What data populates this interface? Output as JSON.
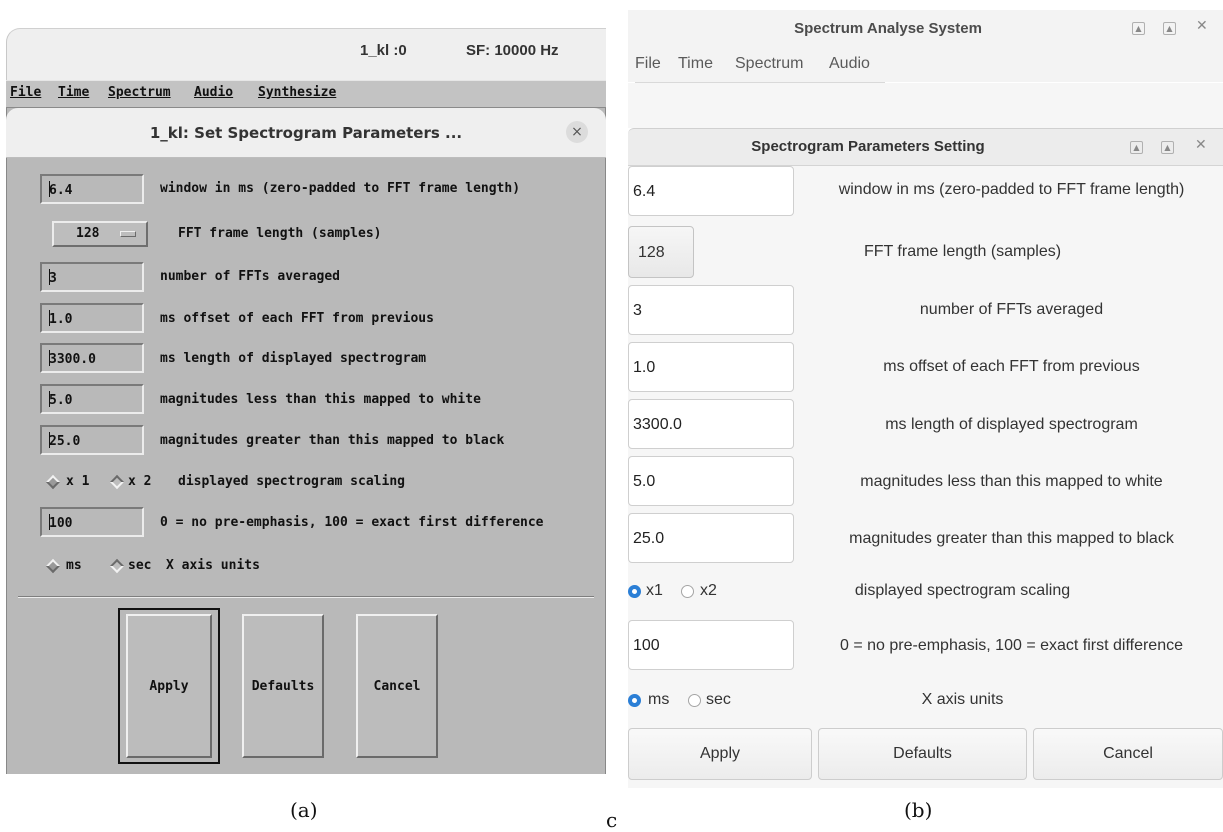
{
  "panel_a": {
    "window_file": "1_kl :0",
    "sample_rate": "SF: 10000 Hz",
    "menu": [
      "File",
      "Time",
      "Spectrum",
      "Audio",
      "Synthesize"
    ],
    "dialog_title": "1_kl:  Set Spectrogram Parameters ...",
    "close_glyph": "×",
    "window_ms": {
      "value": "6.4",
      "label": "window in ms (zero-padded to FFT frame length)"
    },
    "fft_length": {
      "value": "128",
      "label": "FFT frame length (samples)"
    },
    "num_ffts": {
      "value": "3",
      "label": "number of FFTs averaged"
    },
    "offset": {
      "value": "1.0",
      "label": "ms offset of each FFT from previous"
    },
    "length": {
      "value": "3300.0",
      "label": "ms length of displayed spectrogram"
    },
    "mag_white": {
      "value": "5.0",
      "label": "magnitudes less than this mapped to white"
    },
    "mag_black": {
      "value": "25.0",
      "label": "magnitudes greater than this mapped to black"
    },
    "scaling": {
      "opt1": "x 1",
      "opt2": "x 2",
      "label": "displayed spectrogram scaling",
      "selected": "x 1"
    },
    "preemph": {
      "value": "100",
      "label": "0 = no pre-emphasis, 100 = exact first difference"
    },
    "units": {
      "opt1": "ms",
      "opt2": "sec",
      "label": "X axis units",
      "selected": "ms"
    },
    "buttons": {
      "apply": "Apply",
      "defaults": "Defaults",
      "cancel": "Cancel"
    }
  },
  "panel_b": {
    "app_title": "Spectrum Analyse System",
    "menu": [
      "File",
      "Time",
      "Spectrum",
      "Audio"
    ],
    "dialog_title": "Spectrogram Parameters Setting",
    "close_glyph": "✕",
    "window_ms": {
      "value": "6.4",
      "label": "window in ms (zero-padded to FFT frame length)"
    },
    "fft_length": {
      "value": "128",
      "label": "FFT frame length (samples)"
    },
    "num_ffts": {
      "value": "3",
      "label": "number of FFTs averaged"
    },
    "offset": {
      "value": "1.0",
      "label": "ms offset of each FFT from previous"
    },
    "length": {
      "value": "3300.0",
      "label": "ms length of displayed spectrogram"
    },
    "mag_white": {
      "value": "5.0",
      "label": "magnitudes less than this mapped to white"
    },
    "mag_black": {
      "value": "25.0",
      "label": "magnitudes greater than this mapped to black"
    },
    "scaling": {
      "opt1": "x1",
      "opt2": "x2",
      "label": "displayed spectrogram scaling",
      "selected": "x1"
    },
    "preemph": {
      "value": "100",
      "label": "0 = no pre-emphasis, 100 = exact first difference"
    },
    "units": {
      "opt1": "ms",
      "opt2": "sec",
      "label": "X axis units",
      "selected": "ms"
    },
    "buttons": {
      "apply": "Apply",
      "defaults": "Defaults",
      "cancel": "Cancel"
    }
  },
  "captions": {
    "a": "(a)",
    "b": "(b)",
    "c": "c"
  },
  "colors": {
    "motif_gray": "#b9b9b9",
    "gtk_bg": "#f6f6f6",
    "radio_accent": "#2b7fd6"
  }
}
